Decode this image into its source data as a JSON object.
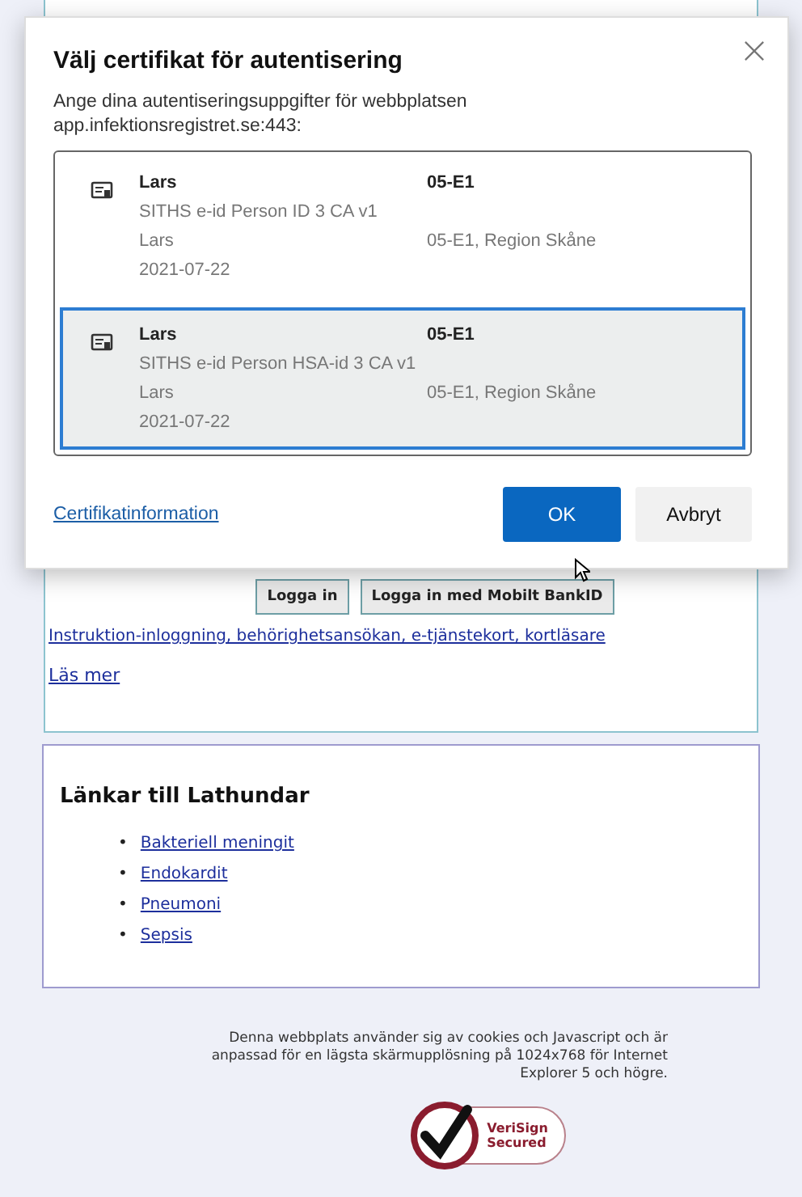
{
  "dialog": {
    "title": "Välj certifikat för autentisering",
    "description": "Ange dina autentiseringsuppgifter för webbplatsen app.infektionsregistret.se:443:",
    "certificates": [
      {
        "subject": "Lars",
        "subject_org": "05-E1",
        "issuer": "SITHS e-id Person ID 3 CA v1",
        "holder": "Lars",
        "holder_org": "05-E1, Region Skåne",
        "date": "2021-07-22",
        "selected": false
      },
      {
        "subject": "Lars",
        "subject_org": "05-E1",
        "issuer": "SITHS e-id Person HSA-id 3 CA v1",
        "holder": "Lars",
        "holder_org": "05-E1, Region Skåne",
        "date": "2021-07-22",
        "selected": true
      }
    ],
    "info_link": "Certifikatinformation",
    "ok_button": "OK",
    "cancel_button": "Avbryt"
  },
  "login": {
    "buttons": [
      "Logga in",
      "Logga in med Mobilt BankID"
    ],
    "instruction_link": "Instruktion-inloggning, behörighetsansökan, e-tjänstekort, kortläsare",
    "read_more": "Läs mer"
  },
  "guides": {
    "title": "Länkar till Lathundar",
    "links": [
      {
        "bullet": "•",
        "label": "Bakteriell meningit"
      },
      {
        "bullet": "•",
        "label": "Endokardit"
      },
      {
        "bullet": "•",
        "label": "Pneumoni"
      },
      {
        "bullet": "•",
        "label": "Sepsis"
      }
    ]
  },
  "footer": {
    "notice": "Denna webbplats använder sig av cookies och Javascript och är anpassad för en lägsta skärmupplösning på 1024x768 för Internet Explorer 5 och högre.",
    "seal": [
      "VeriSign",
      "Secured"
    ]
  }
}
